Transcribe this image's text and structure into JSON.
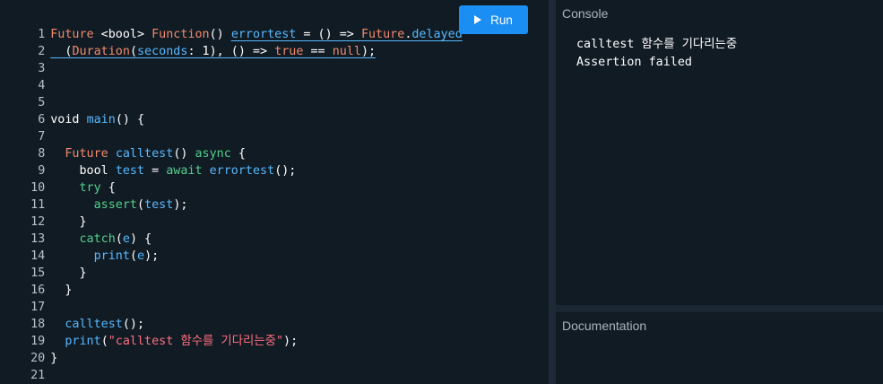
{
  "editor": {
    "line_numbers": [
      "1",
      "2",
      "3",
      "4",
      "5",
      "6",
      "7",
      "8",
      "9",
      "10",
      "11",
      "12",
      "13",
      "14",
      "15",
      "16",
      "17",
      "18",
      "19",
      "20",
      "21"
    ],
    "lines": {
      "l1": [
        "Future",
        " <bool> ",
        "Function",
        "() ",
        "errortest",
        " = () => ",
        "Future",
        ".",
        "delayed"
      ],
      "l2": [
        "  (",
        "Duration",
        "(",
        "seconds",
        ": 1), () => ",
        "true",
        " == ",
        "null",
        ");"
      ],
      "l6": [
        "void ",
        "main",
        "() {"
      ],
      "l8": [
        "  ",
        "Future ",
        "calltest",
        "() ",
        "async",
        " {"
      ],
      "l9": [
        "    bool ",
        "test",
        " = ",
        "await ",
        "errortest",
        "();"
      ],
      "l10": [
        "    ",
        "try",
        " {"
      ],
      "l11": [
        "      ",
        "assert",
        "(",
        "test",
        ");"
      ],
      "l12": [
        "    }"
      ],
      "l13": [
        "    ",
        "catch",
        "(",
        "e",
        ") {"
      ],
      "l14": [
        "      ",
        "print",
        "(",
        "e",
        ");"
      ],
      "l15": [
        "    }"
      ],
      "l16": [
        "  }"
      ],
      "l18": [
        "  ",
        "calltest",
        "();"
      ],
      "l19": [
        "  ",
        "print",
        "(",
        "\"calltest 함수를 기다리는중\"",
        ");"
      ],
      "l20": [
        "}"
      ]
    }
  },
  "toolbar": {
    "run_label": "Run"
  },
  "console": {
    "title": "Console",
    "output": [
      "calltest 함수를 기다리는중",
      "Assertion failed"
    ]
  },
  "documentation": {
    "title": "Documentation"
  },
  "colors": {
    "background": "#111b24",
    "accent": "#1b8ef3",
    "keyword_orange": "#f28a6b",
    "keyword_green": "#53d18b",
    "identifier_blue": "#57b8ff",
    "string_red": "#ff6e7f"
  }
}
